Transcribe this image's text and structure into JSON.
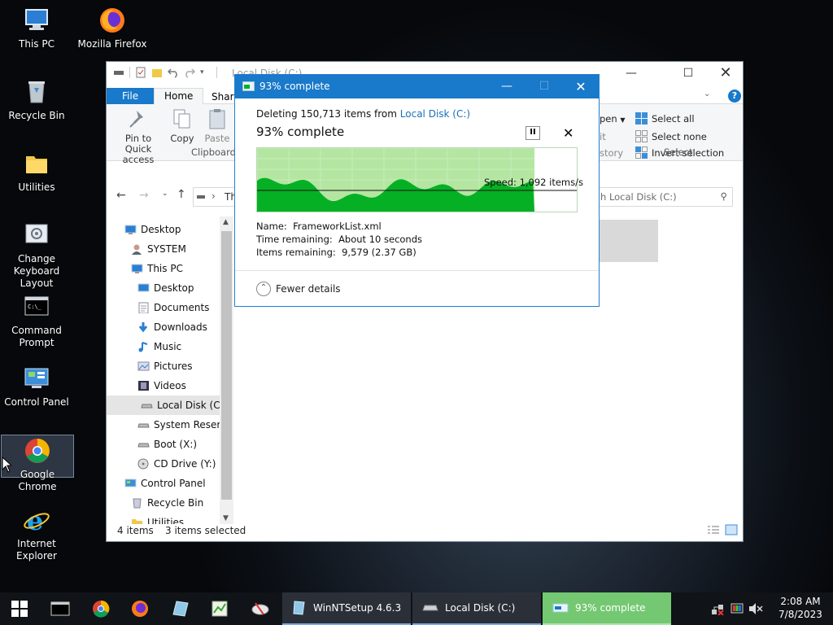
{
  "desktop": {
    "icons": [
      {
        "label": "This PC"
      },
      {
        "label": "Mozilla Firefox"
      },
      {
        "label": "Recycle Bin"
      },
      {
        "label": "Utilities"
      },
      {
        "label": "Change Keyboard Layout"
      },
      {
        "label": "Command Prompt"
      },
      {
        "label": "Control Panel"
      },
      {
        "label": "Google Chrome"
      },
      {
        "label": "Internet Explorer"
      }
    ]
  },
  "explorer": {
    "title": "Local Disk (C:)",
    "tabs": {
      "file": "File",
      "home": "Home",
      "share": "Share"
    },
    "ribbon": {
      "pin": "Pin to Quick access",
      "copy": "Copy",
      "paste": "Paste",
      "clipboard_group": "Clipboard",
      "open_partial": "pen",
      "edit_partial": "it",
      "history_partial": "story",
      "select_all": "Select all",
      "select_none": "Select none",
      "invert_selection": "Invert selection",
      "select_group": "Select"
    },
    "address_partial": "Th",
    "search_placeholder": "h Local Disk (C:)",
    "tree": [
      {
        "label": "Desktop"
      },
      {
        "label": "SYSTEM"
      },
      {
        "label": "This PC"
      },
      {
        "label": "Desktop"
      },
      {
        "label": "Documents"
      },
      {
        "label": "Downloads"
      },
      {
        "label": "Music"
      },
      {
        "label": "Pictures"
      },
      {
        "label": "Videos"
      },
      {
        "label": "Local Disk (C:)"
      },
      {
        "label": "System Reserve"
      },
      {
        "label": "Boot (X:)"
      },
      {
        "label": "CD Drive (Y:) H"
      },
      {
        "label": "Control Panel"
      },
      {
        "label": "Recycle Bin"
      },
      {
        "label": "Utilities"
      }
    ],
    "status": {
      "items": "4 items",
      "selected": "3 items selected"
    }
  },
  "dialog": {
    "title": "93% complete",
    "deleting_prefix": "Deleting 150,713 items from ",
    "source": "Local Disk (C:)",
    "big_status": "93% complete",
    "progress_percent": 93,
    "speed": "Speed: 1,092 items/s",
    "name_label": "Name:",
    "name_value": "FrameworkList.xml",
    "time_label": "Time remaining:",
    "time_value": "About 10 seconds",
    "items_label": "Items remaining:",
    "items_value": "9,579 (2.37 GB)",
    "fewer_details": "Fewer details"
  },
  "taskbar": {
    "tasks": [
      {
        "label": "WinNTSetup 4.6.3"
      },
      {
        "label": "Local Disk (C:)"
      },
      {
        "label": "93% complete"
      }
    ],
    "time": "2:08 AM",
    "date": "7/8/2023"
  },
  "colors": {
    "accent": "#1979ca",
    "progress_green": "#06b025",
    "progress_fill": "#b4e6a2"
  }
}
